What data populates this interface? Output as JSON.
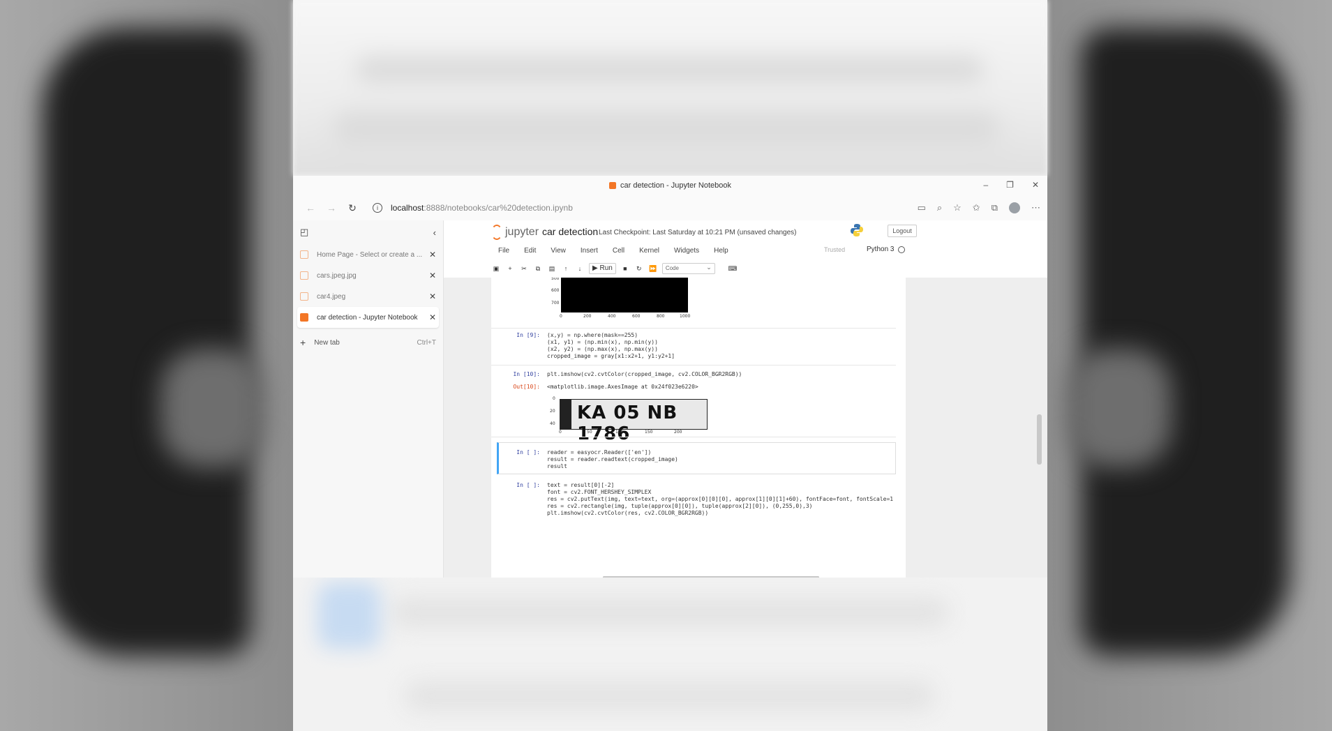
{
  "browser": {
    "window_title": "car detection - Jupyter Notebook",
    "url_host": "localhost",
    "url_path": ":8888/notebooks/car%20detection.ipynb"
  },
  "sidebar": {
    "tabs": [
      {
        "label": "Home Page - Select or create a ..."
      },
      {
        "label": "cars.jpeg.jpg"
      },
      {
        "label": "car4.jpeg"
      },
      {
        "label": "car detection - Jupyter Notebook"
      }
    ],
    "new_tab_label": "New tab",
    "new_tab_shortcut": "Ctrl+T"
  },
  "jupyter": {
    "logo_text": "jupyter",
    "notebook_title": "car detection",
    "checkpoint": "Last Checkpoint: Last Saturday at 10:21 PM  (unsaved changes)",
    "logout_label": "Logout",
    "trusted_label": "Trusted",
    "kernel_name": "Python 3",
    "menu": [
      "File",
      "Edit",
      "View",
      "Insert",
      "Cell",
      "Kernel",
      "Widgets",
      "Help"
    ],
    "run_label": "Run",
    "cell_type": "Code"
  },
  "cells": {
    "plot1_yticks": [
      "500",
      "600",
      "700"
    ],
    "plot1_xticks": [
      "0",
      "200",
      "400",
      "600",
      "800",
      "1000"
    ],
    "cell9_prompt": "In [9]:",
    "cell9_lines": [
      "(x,y) = np.where(mask==255)",
      "(x1, y1) = (np.min(x), np.min(y))",
      "(x2, y2) = (np.max(x), np.max(y))",
      "cropped_image = gray[x1:x2+1, y1:y2+1]"
    ],
    "cell10_prompt": "In [10]:",
    "cell10_lines": [
      "plt.imshow(cv2.cvtColor(cropped_image, cv2.COLOR_BGR2RGB))"
    ],
    "out10_prompt": "Out[10]:",
    "out10_text": "<matplotlib.image.AxesImage at 0x24f023e6220>",
    "plate_text": "KA 05 NB 1786",
    "plot2_yticks": [
      "0",
      "20",
      "40"
    ],
    "plot2_xticks": [
      "0",
      "50",
      "100",
      "150",
      "200"
    ],
    "cell_a_prompt": "In [ ]:",
    "cell_a_lines": [
      "reader = easyocr.Reader(['en'])",
      "result = reader.readtext(cropped_image)",
      "result"
    ],
    "cell_b_prompt": "In [ ]:",
    "cell_b_lines": [
      "text = result[0][-2]",
      "font = cv2.FONT_HERSHEY_SIMPLEX",
      "res = cv2.putText(img, text=text, org=(approx[0][0][0], approx[1][0][1]+60), fontFace=font, fontScale=1",
      "res = cv2.rectangle(img, tuple(approx[0][0]), tuple(approx[2][0]), (0,255,0),3)",
      "plt.imshow(cv2.cvtColor(res, cv2.COLOR_BGR2RGB))"
    ]
  },
  "colors": {
    "jupyter_orange": "#f37626",
    "prompt_in": "#303f9f",
    "prompt_out": "#d84315",
    "selected_cell": "#42a5f5"
  }
}
